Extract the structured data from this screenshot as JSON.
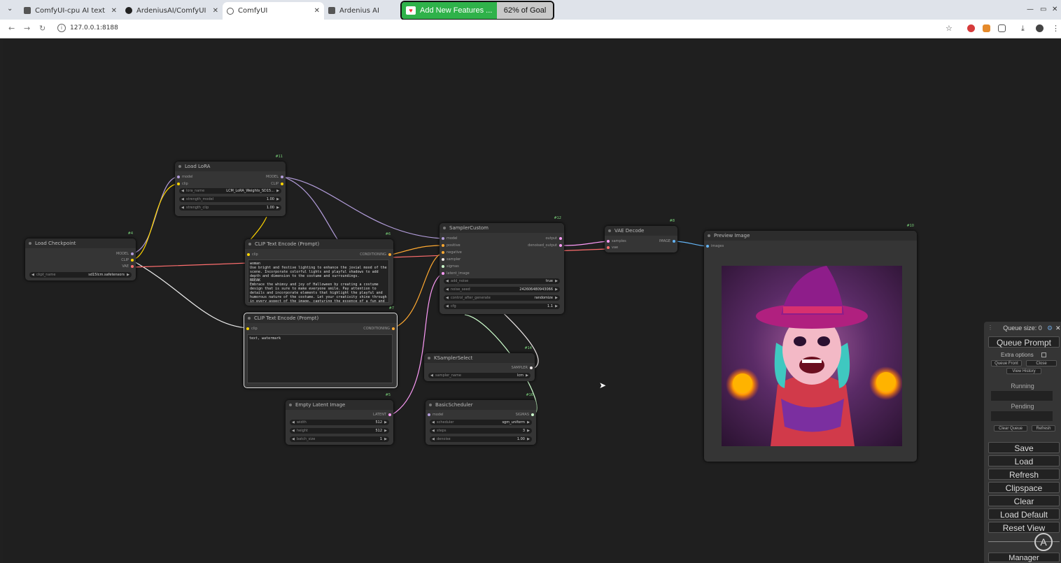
{
  "browser": {
    "tabs": [
      {
        "title": "ComfyUI-cpu AI text to i",
        "active": false
      },
      {
        "title": "ArdeniusAI/ComfyUI-cpu",
        "active": false
      },
      {
        "title": "ComfyUI",
        "active": true
      },
      {
        "title": "Ardenius AI",
        "active": false
      }
    ],
    "promo": {
      "label": "Add New Features ...",
      "goal": "62% of Goal"
    },
    "url": "127.0.0.1:8188"
  },
  "nodes": {
    "load_lora": {
      "id": "#11",
      "title": "Load LoRA",
      "inputs": [
        "model",
        "clip"
      ],
      "outputs": [
        "MODEL",
        "CLIP"
      ],
      "widgets": [
        {
          "label": "lora_name",
          "value": "LCM_LoRA_Weights_SD15..."
        },
        {
          "label": "strength_model",
          "value": "1.00"
        },
        {
          "label": "strength_clip",
          "value": "1.00"
        }
      ]
    },
    "load_checkpoint": {
      "id": "#4",
      "title": "Load Checkpoint",
      "outputs": [
        "MODEL",
        "CLIP",
        "VAE"
      ],
      "widgets": [
        {
          "label": "ckpt_name",
          "value": "sd15lcm.safetensors"
        }
      ]
    },
    "clip_pos": {
      "id": "#6",
      "title": "CLIP Text Encode (Prompt)",
      "inputs": [
        "clip"
      ],
      "outputs": [
        "CONDITIONING"
      ],
      "text": "woman\nUse bright and festive lighting to enhance the jovial mood of the scene. Incorporate colorful lights and playful shadows to add depth and dimension to the costume and surroundings.\nBREAK\nEmbrace the whimsy and joy of Halloween by creating a costume design that is sure to make everyone smile. Pay attention to details and incorporate elements that highlight the playful and humorous nature of the costume. Let your creativity shine through in every aspect of the image, capturing the essence of a fun and memorable Halloween celebration."
    },
    "clip_neg": {
      "id": "#7",
      "title": "CLIP Text Encode (Prompt)",
      "inputs": [
        "clip"
      ],
      "outputs": [
        "CONDITIONING"
      ],
      "text": "text, watermark"
    },
    "sampler_custom": {
      "id": "#12",
      "title": "SamplerCustom",
      "inputs": [
        "model",
        "positive",
        "negative",
        "sampler",
        "sigmas",
        "latent_image"
      ],
      "outputs": [
        "output",
        "denoised_output"
      ],
      "widgets": [
        {
          "label": "add_noise",
          "value": "true"
        },
        {
          "label": "noise_seed",
          "value": "242606480943066"
        },
        {
          "label": "control_after_generate",
          "value": "randomize"
        },
        {
          "label": "cfg",
          "value": "1.1"
        }
      ]
    },
    "vae_decode": {
      "id": "#8",
      "title": "VAE Decode",
      "inputs": [
        "samples",
        "vae"
      ],
      "outputs": [
        "IMAGE"
      ]
    },
    "preview": {
      "id": "#10",
      "title": "Preview Image",
      "inputs": [
        "images"
      ]
    },
    "ksampler_select": {
      "id": "#14",
      "title": "KSamplerSelect",
      "outputs": [
        "SAMPLER"
      ],
      "widgets": [
        {
          "label": "sampler_name",
          "value": "lcm"
        }
      ]
    },
    "empty_latent": {
      "id": "#5",
      "title": "Empty Latent Image",
      "outputs": [
        "LATENT"
      ],
      "widgets": [
        {
          "label": "width",
          "value": "512"
        },
        {
          "label": "height",
          "value": "512"
        },
        {
          "label": "batch_size",
          "value": "1"
        }
      ]
    },
    "basic_scheduler": {
      "id": "#16",
      "title": "BasicScheduler",
      "inputs": [
        "model"
      ],
      "outputs": [
        "SIGMAS"
      ],
      "widgets": [
        {
          "label": "scheduler",
          "value": "sgm_uniform"
        },
        {
          "label": "steps",
          "value": "3"
        },
        {
          "label": "denoise",
          "value": "1.00"
        }
      ]
    }
  },
  "panel": {
    "queue_size": "Queue size: 0",
    "queue_prompt": "Queue Prompt",
    "extra_options": "Extra options",
    "queue_front": "Queue Front",
    "close": "Close",
    "view_history": "View History",
    "running": "Running",
    "pending": "Pending",
    "clear_queue": "Clear Queue",
    "refresh_small": "Refresh",
    "buttons": [
      "Save",
      "Load",
      "Refresh",
      "Clipspace",
      "Clear",
      "Load Default",
      "Reset View",
      "Manager"
    ]
  },
  "colors": {
    "model": "#b39ddb",
    "clip": "#ffd500",
    "vae": "#ff6e6e",
    "conditioning": "#ffa931",
    "latent": "#ff9cf9",
    "sampler": "#ece7e7",
    "sigmas": "#cdffcd",
    "image": "#64b5f6"
  }
}
